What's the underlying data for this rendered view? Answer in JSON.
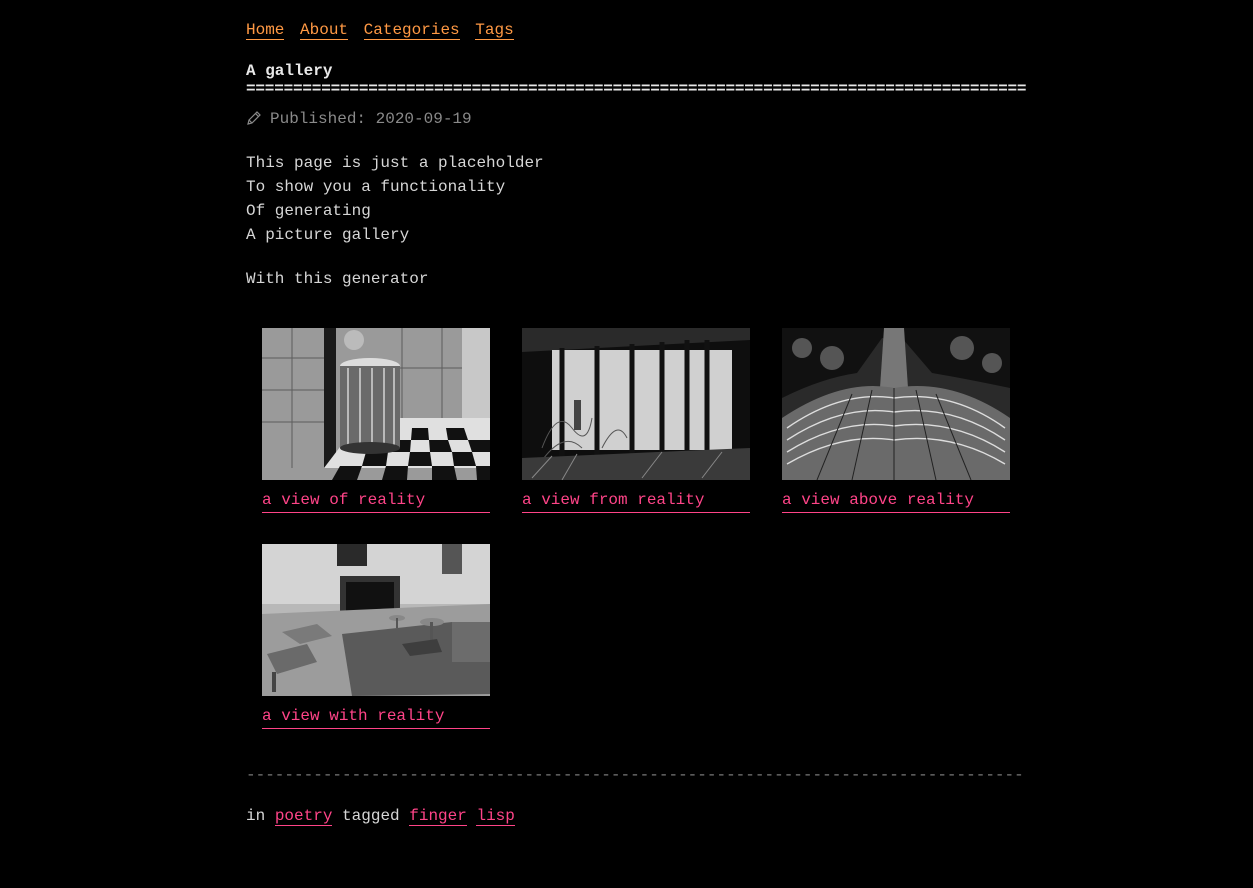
{
  "nav": {
    "home": "Home",
    "about": "About",
    "categories": "Categories",
    "tags": "Tags"
  },
  "post": {
    "title": "A gallery",
    "title_underline": "=========================================================================================",
    "published_icon": "pencil-icon",
    "published": "Published: 2020-09-19",
    "lines": [
      "This page is just a placeholder",
      "To show you a functionality",
      "Of generating",
      "A picture gallery"
    ],
    "second_paragraph": "With this generator"
  },
  "gallery": [
    {
      "caption": "a view of reality"
    },
    {
      "caption": "a view from reality"
    },
    {
      "caption": "a view above reality"
    },
    {
      "caption": "a view with reality"
    }
  ],
  "footer": {
    "divider": "------------------------------------------------------------------------------------------",
    "in_label": "in",
    "category": "poetry",
    "tagged_label": "tagged",
    "tags": [
      "finger",
      "lisp"
    ]
  },
  "colors": {
    "background": "#000000",
    "nav_link": "#ff9944",
    "accent_link": "#ff4488",
    "text": "#d6d6d6",
    "muted": "#8a8a8a"
  }
}
